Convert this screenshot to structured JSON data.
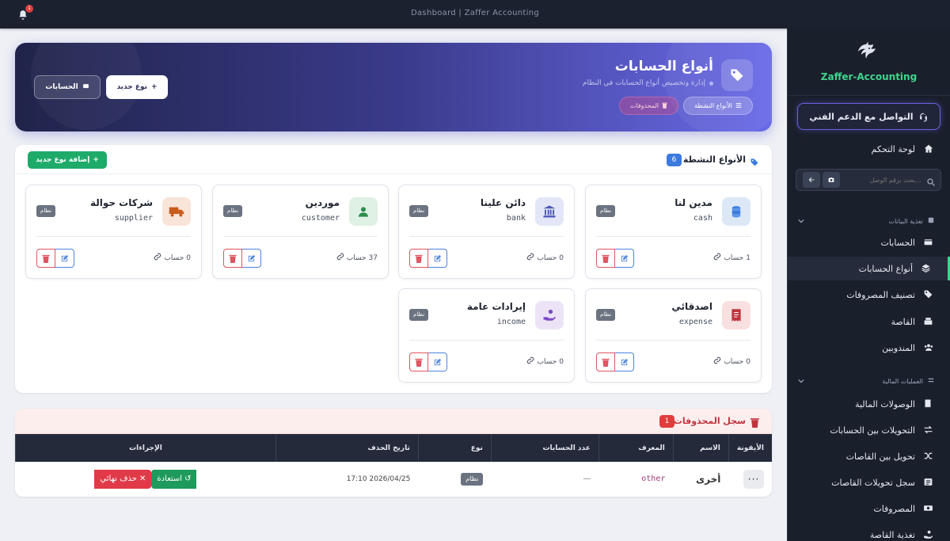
{
  "topbar": {
    "title": "Dashboard | Zaffer Accounting",
    "notifications": "1"
  },
  "sidebar": {
    "brand": "Zaffer-Accounting",
    "support": "التواصل مع الدعم الفني",
    "dashboard": "لوحة التحكم",
    "search_placeholder": "بحث برقم الوصل...",
    "sections": [
      {
        "title": "تغذية البيانات",
        "items": [
          "الحسابات",
          "أنواع الحسابات",
          "تصنيف المصروفات",
          "القاصة",
          "المندوبين"
        ]
      },
      {
        "title": "العمليات المالية",
        "items": [
          "الوصولات المالية",
          "التحويلات بين الحسابات",
          "تحويل بين القاصات",
          "سجل تحويلات القاصات",
          "المصروفات",
          "تغذية القاصة"
        ]
      }
    ]
  },
  "hero": {
    "title": "أنواع الحسابات",
    "subtitle": "إدارة وتخصيص أنواع الحسابات في النظام",
    "pill_active": "الأنواع النشطة",
    "pill_deleted": "المحذوفات",
    "btn_new": "نوع جديد",
    "btn_accounts": "الحسابات"
  },
  "active_panel": {
    "title": "الأنواع النشطة",
    "count": "6",
    "add_button": "إضافة نوع جديد",
    "system_label": "نظام",
    "accounts_suffix": "حساب",
    "cards": [
      {
        "name": "مدين لنا",
        "code": "cash",
        "count": "1",
        "icon": "coins-icon",
        "color": "#dde8f7"
      },
      {
        "name": "دائن علينا",
        "code": "bank",
        "count": "0",
        "icon": "bank-icon",
        "color": "#e3e6f7"
      },
      {
        "name": "موردين",
        "code": "customer",
        "count": "37",
        "icon": "user-icon",
        "color": "#dff0e4"
      },
      {
        "name": "شركات حوالة",
        "code": "supplier",
        "count": "0",
        "icon": "truck-icon",
        "color": "#f8e4d8"
      },
      {
        "name": "اصدقائي",
        "code": "expense",
        "count": "0",
        "icon": "receipt-icon",
        "color": "#f8e0e0"
      },
      {
        "name": "إيرادات عامة",
        "code": "income",
        "count": "0",
        "icon": "hand-coin-icon",
        "color": "#ece4f6"
      }
    ]
  },
  "deleted_panel": {
    "title": "سجل المحذوفات",
    "count": "1",
    "columns": [
      "الأيقونة",
      "الاسم",
      "المعرف",
      "عدد الحسابات",
      "نوع",
      "تاريخ الحذف",
      "الإجراءات"
    ],
    "rows": [
      {
        "icon": "···",
        "name": "أخرى",
        "code": "other",
        "count": "—",
        "type": "نظام",
        "date": "2026/04/25 17:10",
        "restore": "استعادة",
        "hard_delete": "حذف نهائي"
      }
    ]
  }
}
